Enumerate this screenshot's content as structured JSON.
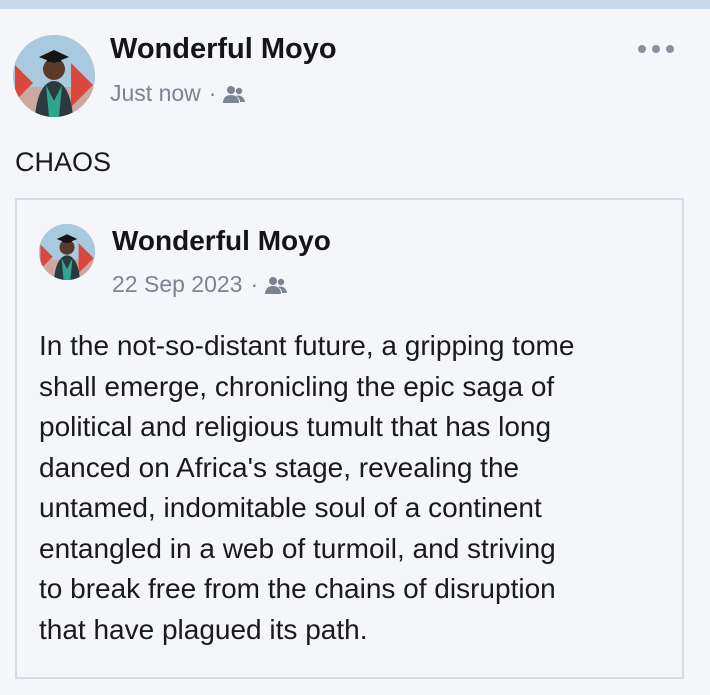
{
  "post": {
    "author": "Wonderful Moyo",
    "timestamp": "Just now",
    "separator": "·",
    "audience_icon": "friends-icon",
    "more_icon": "more-options-icon",
    "text": "CHAOS"
  },
  "shared_post": {
    "author": "Wonderful Moyo",
    "timestamp": "22 Sep 2023",
    "separator": "·",
    "audience_icon": "friends-icon",
    "lines": [
      "In the not-so-distant future, a gripping tome",
      "shall emerge, chronicling the epic saga of",
      "political and religious tumult that has long",
      "danced on Africa's stage, revealing the",
      "untamed, indomitable soul of a continent",
      "entangled in a web of turmoil, and striving",
      "to break free from the chains of disruption",
      "that have plagued its path."
    ]
  },
  "colors": {
    "top_bar": "#c9d8ea",
    "meta_text": "#7b8490",
    "card_border": "#d3dde6"
  }
}
